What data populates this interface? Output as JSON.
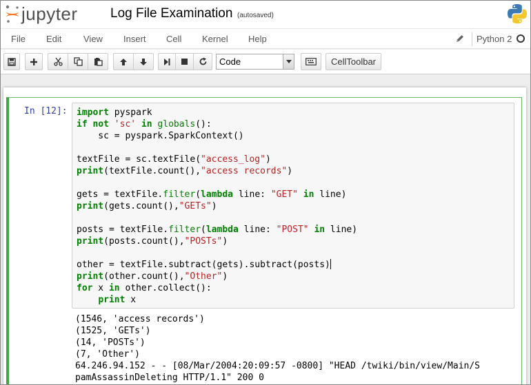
{
  "header": {
    "logo_text": "jupyter",
    "notebook_title": "Log File Examination",
    "autosave_status": "(autosaved)"
  },
  "menubar": {
    "items": [
      "File",
      "Edit",
      "View",
      "Insert",
      "Cell",
      "Kernel",
      "Help"
    ],
    "kernel_name": "Python 2"
  },
  "toolbar": {
    "cell_type": "Code",
    "celltoolbar_label": "CellToolbar",
    "buttons": [
      "save-icon",
      "plus-icon",
      "cut-icon",
      "copy-icon",
      "paste-icon",
      "arrow-up-icon",
      "arrow-down-icon",
      "run-icon",
      "stop-icon",
      "restart-icon",
      "keyboard-icon"
    ]
  },
  "cell": {
    "prompt": "In [12]:",
    "code_lines": [
      "import pyspark",
      "if not 'sc' in globals():",
      "    sc = pyspark.SparkContext()",
      "",
      "textFile = sc.textFile(\"access_log\")",
      "print(textFile.count(),\"access records\")",
      "",
      "gets = textFile.filter(lambda line: \"GET\" in line)",
      "print(gets.count(),\"GETs\")",
      "",
      "posts = textFile.filter(lambda line: \"POST\" in line)",
      "print(posts.count(),\"POSTs\")",
      "",
      "other = textFile.subtract(gets).subtract(posts)",
      "print(other.count(),\"Other\")",
      "for x in other.collect():",
      "    print x"
    ],
    "output_lines": [
      "(1546, 'access records')",
      "(1525, 'GETs')",
      "(14, 'POSTs')",
      "(7, 'Other')",
      "64.246.94.152 - - [08/Mar/2004:20:09:57 -0800] \"HEAD /twiki/bin/view/Main/S",
      "pamAssassinDeleting HTTP/1.1\" 200 0"
    ]
  },
  "colors": {
    "prompt": "#303f9f",
    "keyword": "#008000",
    "string": "#ba2121",
    "cell_border": "#42a542"
  }
}
